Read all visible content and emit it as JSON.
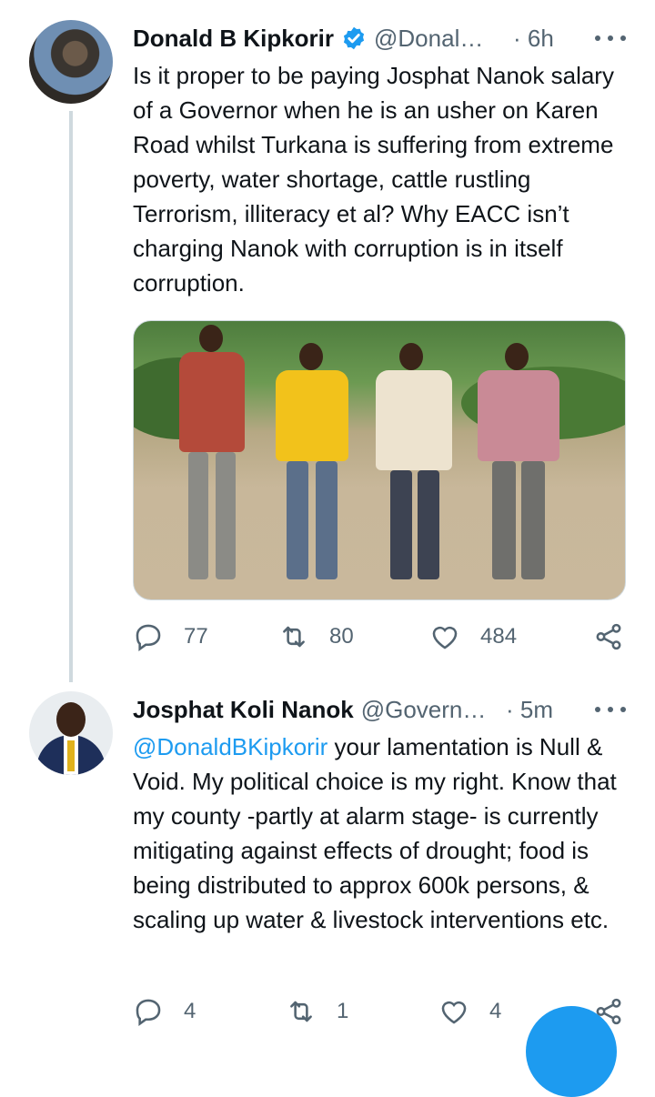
{
  "tweets": [
    {
      "author_name": "Donald B Kipkorir",
      "handle": "@Donal…",
      "time": "· 6h",
      "verified": true,
      "text": "Is it proper to be paying Josphat Nanok salary of a Governor when he is an usher on Karen Road whilst Turkana is suffering from extreme poverty, water shortage, cattle rustling Terrorism, illiteracy et al? Why EACC isn’t charging Nanok with corruption is in itself corruption.",
      "replies": "77",
      "retweets": "80",
      "likes": "484"
    },
    {
      "author_name": "Josphat Koli Nanok",
      "handle": "@Govern…",
      "time": "· 5m",
      "mention": "@DonaldBKipkorir",
      "text": " your lamentation is Null & Void. My political choice is my right. Know that my county -partly at alarm stage- is currently mitigating against effects of drought; food is being distributed to approx 600k persons, & scaling up water & livestock interventions etc.",
      "replies": "4",
      "retweets": "1",
      "likes": "4"
    }
  ],
  "icons": {
    "reply": "reply-icon",
    "retweet": "retweet-icon",
    "like": "heart-icon",
    "share": "share-icon",
    "more": "more-dots-icon",
    "verified": "verified-badge-icon"
  },
  "colors": {
    "accent": "#1d9bf0",
    "secondary_text": "#536471",
    "thread_line": "#cfd9de"
  }
}
